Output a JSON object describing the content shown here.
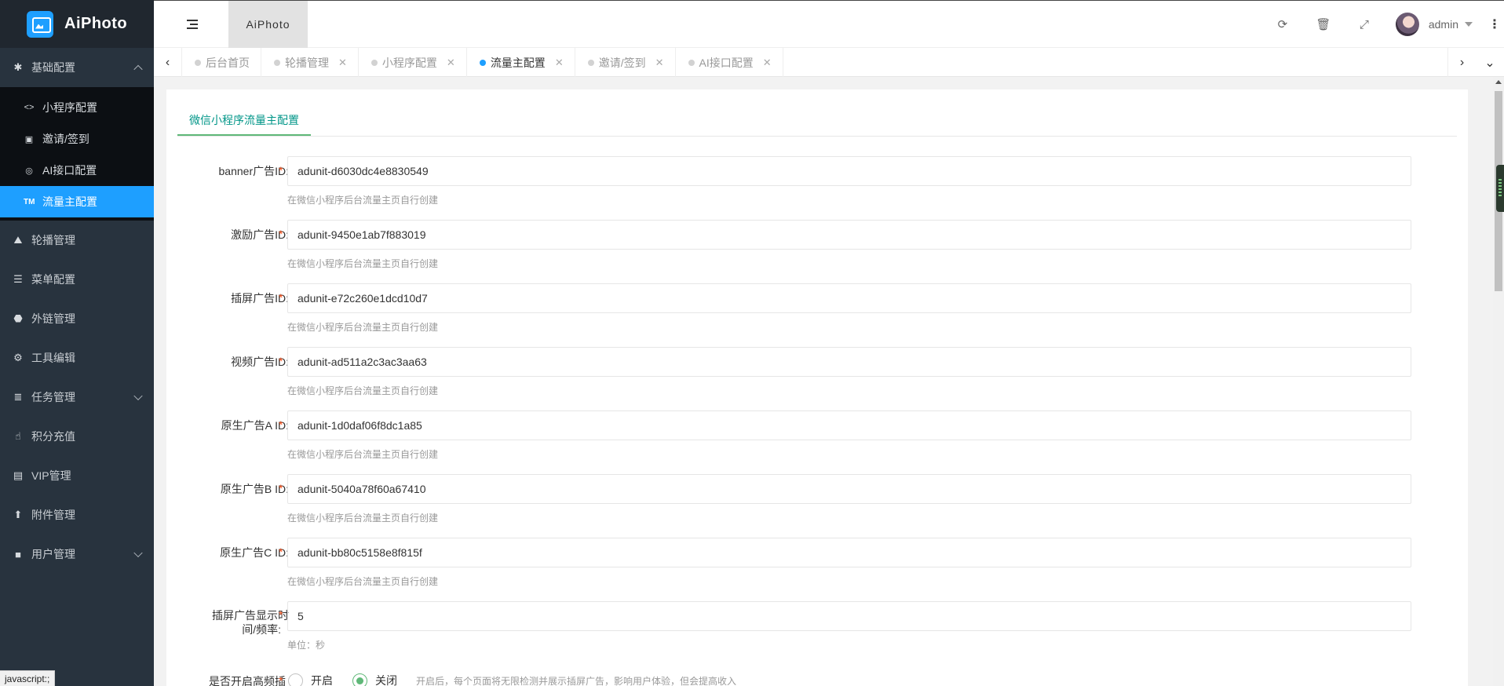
{
  "app": {
    "name": "AiPhoto",
    "header_tab": "AiPhoto"
  },
  "sidebar": {
    "groups": [
      {
        "label": "基础配置",
        "icon": "asterisk-icon",
        "glyph": "✱",
        "expanded": true,
        "children": [
          {
            "label": "小程序配置",
            "icon": "code-icon",
            "glyph": "<>"
          },
          {
            "label": "邀请/签到",
            "icon": "contact-icon",
            "glyph": "▣"
          },
          {
            "label": "AI接口配置",
            "icon": "chrome-icon",
            "glyph": "◎"
          },
          {
            "label": "流量主配置",
            "icon": "trademark-icon",
            "glyph": "TM",
            "active": true
          }
        ]
      },
      {
        "label": "轮播管理",
        "icon": "area-chart-icon",
        "glyph": "⛰"
      },
      {
        "label": "菜单配置",
        "icon": "bars-icon",
        "glyph": "☰"
      },
      {
        "label": "外链管理",
        "icon": "android-icon",
        "glyph": "⬣"
      },
      {
        "label": "工具编辑",
        "icon": "gear-icon",
        "glyph": "⚙"
      },
      {
        "label": "任务管理",
        "icon": "list-icon",
        "glyph": "≣",
        "has_children": true
      },
      {
        "label": "积分充值",
        "icon": "hand-pointer-icon",
        "glyph": "☝"
      },
      {
        "label": "VIP管理",
        "icon": "id-card-icon",
        "glyph": "▤"
      },
      {
        "label": "附件管理",
        "icon": "arrow-up-icon",
        "glyph": "⬆"
      },
      {
        "label": "用户管理",
        "icon": "user-icon",
        "glyph": "👤",
        "has_children": true
      }
    ]
  },
  "header": {
    "icons": [
      "refresh-icon",
      "trash-icon",
      "fullscreen-icon"
    ],
    "user": {
      "name": "admin"
    }
  },
  "tabs": [
    {
      "label": "后台首页",
      "closable": false
    },
    {
      "label": "轮播管理",
      "closable": true
    },
    {
      "label": "小程序配置",
      "closable": true
    },
    {
      "label": "流量主配置",
      "closable": true,
      "active": true
    },
    {
      "label": "邀请/签到",
      "closable": true
    },
    {
      "label": "AI接口配置",
      "closable": true
    }
  ],
  "page": {
    "section_tab": "微信小程序流量主配置",
    "fields": [
      {
        "label": "banner广告ID:",
        "value": "adunit-d6030dc4e8830549",
        "hint": "在微信小程序后台流量主页自行创建"
      },
      {
        "label": "激励广告ID:",
        "value": "adunit-9450e1ab7f883019",
        "hint": "在微信小程序后台流量主页自行创建"
      },
      {
        "label": "插屏广告ID:",
        "value": "adunit-e72c260e1dcd10d7",
        "hint": "在微信小程序后台流量主页自行创建"
      },
      {
        "label": "视频广告ID:",
        "value": "adunit-ad511a2c3ac3aa63",
        "hint": "在微信小程序后台流量主页自行创建"
      },
      {
        "label": "原生广告A ID:",
        "value": "adunit-1d0daf06f8dc1a85",
        "hint": "在微信小程序后台流量主页自行创建"
      },
      {
        "label": "原生广告B ID:",
        "value": "adunit-5040a78f60a67410",
        "hint": "在微信小程序后台流量主页自行创建"
      },
      {
        "label": "原生广告C ID:",
        "value": "adunit-bb80c5158e8f815f",
        "hint": "在微信小程序后台流量主页自行创建"
      },
      {
        "label_line1": "插屏广告显示时",
        "label_line2": "间/频率:",
        "value": "5",
        "hint": "单位：秒"
      }
    ],
    "high_freq": {
      "label": "是否开启高频插",
      "option_on": "开启",
      "option_off": "关闭",
      "selected": "关闭",
      "hint": "开启后，每个页面将无限检测并展示插屏广告，影响用户体验，但会提高收入"
    }
  },
  "statusbar": {
    "text": "javascript:;"
  },
  "colors": {
    "accent": "#1e9fff",
    "sidebar": "#28333e",
    "green": "#5fb878",
    "teal": "#009688",
    "required": "#ff5722"
  }
}
